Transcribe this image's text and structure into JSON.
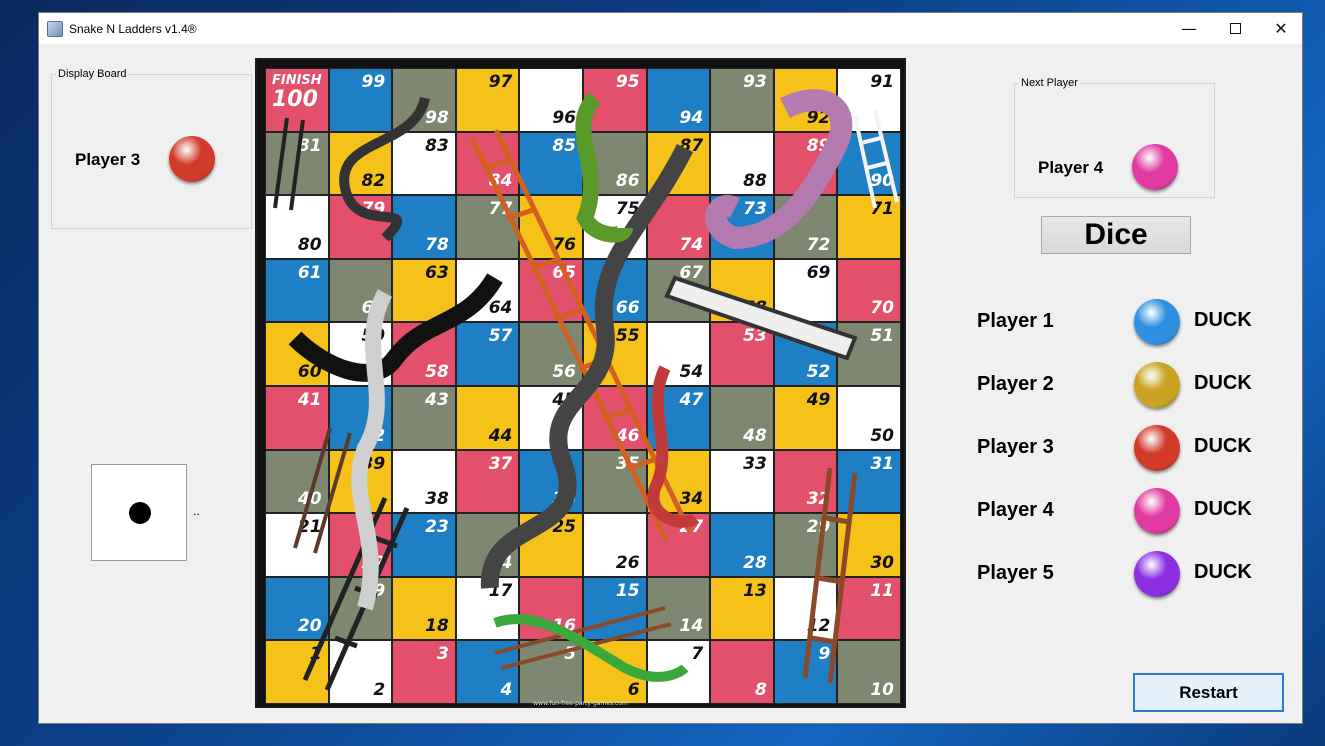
{
  "window": {
    "title": "Snake N Ladders v1.4®",
    "minimize_icon": "minimize-icon",
    "maximize_icon": "maximize-icon",
    "close_icon": "close-icon"
  },
  "display_board": {
    "legend": "Display Board",
    "player_label": "Player 3",
    "player_color": "#d23a2a"
  },
  "next_player": {
    "legend": "Next Player",
    "player_label": "Player 4",
    "player_color": "#e13aa2"
  },
  "dice_button": {
    "label": "Dice"
  },
  "die": {
    "face_value": 1,
    "status": ".."
  },
  "players": [
    {
      "label": "Player 1",
      "status": "DUCK",
      "color": "#2f8fe0"
    },
    {
      "label": "Player 2",
      "status": "DUCK",
      "color": "#c9a21f"
    },
    {
      "label": "Player 3",
      "status": "DUCK",
      "color": "#d23a2a"
    },
    {
      "label": "Player 4",
      "status": "DUCK",
      "color": "#e13aa2"
    },
    {
      "label": "Player 5",
      "status": "DUCK",
      "color": "#8c2fe0"
    }
  ],
  "restart_button": {
    "label": "Restart"
  },
  "board": {
    "finish_label": "FINISH",
    "finish_number": "100",
    "credit": "www.fun-free-party-games.com",
    "palette": {
      "red": "#e2506b",
      "blue": "#1f7fc4",
      "gray": "#7e8770",
      "yellow": "#f5c21a",
      "white": "#ffffff"
    },
    "rows": [
      [
        {
          "n": "100",
          "c": "red"
        },
        {
          "n": "99",
          "c": "blue"
        },
        {
          "n": "98",
          "c": "gray"
        },
        {
          "n": "97",
          "c": "yellow"
        },
        {
          "n": "96",
          "c": "white"
        },
        {
          "n": "95",
          "c": "red"
        },
        {
          "n": "94",
          "c": "blue"
        },
        {
          "n": "93",
          "c": "gray"
        },
        {
          "n": "92",
          "c": "yellow"
        },
        {
          "n": "91",
          "c": "white"
        }
      ],
      [
        {
          "n": "81",
          "c": "gray"
        },
        {
          "n": "82",
          "c": "yellow"
        },
        {
          "n": "83",
          "c": "white"
        },
        {
          "n": "84",
          "c": "red"
        },
        {
          "n": "85",
          "c": "blue"
        },
        {
          "n": "86",
          "c": "gray"
        },
        {
          "n": "87",
          "c": "yellow"
        },
        {
          "n": "88",
          "c": "white"
        },
        {
          "n": "89",
          "c": "red"
        },
        {
          "n": "90",
          "c": "blue"
        }
      ],
      [
        {
          "n": "80",
          "c": "white"
        },
        {
          "n": "79",
          "c": "red"
        },
        {
          "n": "78",
          "c": "blue"
        },
        {
          "n": "77",
          "c": "gray"
        },
        {
          "n": "76",
          "c": "yellow"
        },
        {
          "n": "75",
          "c": "white"
        },
        {
          "n": "74",
          "c": "red"
        },
        {
          "n": "73",
          "c": "blue"
        },
        {
          "n": "72",
          "c": "gray"
        },
        {
          "n": "71",
          "c": "yellow"
        }
      ],
      [
        {
          "n": "61",
          "c": "blue"
        },
        {
          "n": "62",
          "c": "gray"
        },
        {
          "n": "63",
          "c": "yellow"
        },
        {
          "n": "64",
          "c": "white"
        },
        {
          "n": "65",
          "c": "red"
        },
        {
          "n": "66",
          "c": "blue"
        },
        {
          "n": "67",
          "c": "gray"
        },
        {
          "n": "68",
          "c": "yellow"
        },
        {
          "n": "69",
          "c": "white"
        },
        {
          "n": "70",
          "c": "red"
        }
      ],
      [
        {
          "n": "60",
          "c": "yellow"
        },
        {
          "n": "59",
          "c": "white"
        },
        {
          "n": "58",
          "c": "red"
        },
        {
          "n": "57",
          "c": "blue"
        },
        {
          "n": "56",
          "c": "gray"
        },
        {
          "n": "55",
          "c": "yellow"
        },
        {
          "n": "54",
          "c": "white"
        },
        {
          "n": "53",
          "c": "red"
        },
        {
          "n": "52",
          "c": "blue"
        },
        {
          "n": "51",
          "c": "gray"
        }
      ],
      [
        {
          "n": "41",
          "c": "red"
        },
        {
          "n": "42",
          "c": "blue"
        },
        {
          "n": "43",
          "c": "gray"
        },
        {
          "n": "44",
          "c": "yellow"
        },
        {
          "n": "45",
          "c": "white"
        },
        {
          "n": "46",
          "c": "red"
        },
        {
          "n": "47",
          "c": "blue"
        },
        {
          "n": "48",
          "c": "gray"
        },
        {
          "n": "49",
          "c": "yellow"
        },
        {
          "n": "50",
          "c": "white"
        }
      ],
      [
        {
          "n": "40",
          "c": "gray"
        },
        {
          "n": "39",
          "c": "yellow"
        },
        {
          "n": "38",
          "c": "white"
        },
        {
          "n": "37",
          "c": "red"
        },
        {
          "n": "36",
          "c": "blue"
        },
        {
          "n": "35",
          "c": "gray"
        },
        {
          "n": "34",
          "c": "yellow"
        },
        {
          "n": "33",
          "c": "white"
        },
        {
          "n": "32",
          "c": "red"
        },
        {
          "n": "31",
          "c": "blue"
        }
      ],
      [
        {
          "n": "21",
          "c": "white"
        },
        {
          "n": "22",
          "c": "red"
        },
        {
          "n": "23",
          "c": "blue"
        },
        {
          "n": "24",
          "c": "gray"
        },
        {
          "n": "25",
          "c": "yellow"
        },
        {
          "n": "26",
          "c": "white"
        },
        {
          "n": "27",
          "c": "red"
        },
        {
          "n": "28",
          "c": "blue"
        },
        {
          "n": "29",
          "c": "gray"
        },
        {
          "n": "30",
          "c": "yellow"
        }
      ],
      [
        {
          "n": "20",
          "c": "blue"
        },
        {
          "n": "19",
          "c": "gray"
        },
        {
          "n": "18",
          "c": "yellow"
        },
        {
          "n": "17",
          "c": "white"
        },
        {
          "n": "16",
          "c": "red"
        },
        {
          "n": "15",
          "c": "blue"
        },
        {
          "n": "14",
          "c": "gray"
        },
        {
          "n": "13",
          "c": "yellow"
        },
        {
          "n": "12",
          "c": "white"
        },
        {
          "n": "11",
          "c": "red"
        }
      ],
      [
        {
          "n": "1",
          "c": "yellow"
        },
        {
          "n": "2",
          "c": "white"
        },
        {
          "n": "3",
          "c": "red"
        },
        {
          "n": "4",
          "c": "blue"
        },
        {
          "n": "5",
          "c": "gray"
        },
        {
          "n": "6",
          "c": "yellow"
        },
        {
          "n": "7",
          "c": "white"
        },
        {
          "n": "8",
          "c": "red"
        },
        {
          "n": "9",
          "c": "blue"
        },
        {
          "n": "10",
          "c": "gray"
        }
      ]
    ]
  }
}
